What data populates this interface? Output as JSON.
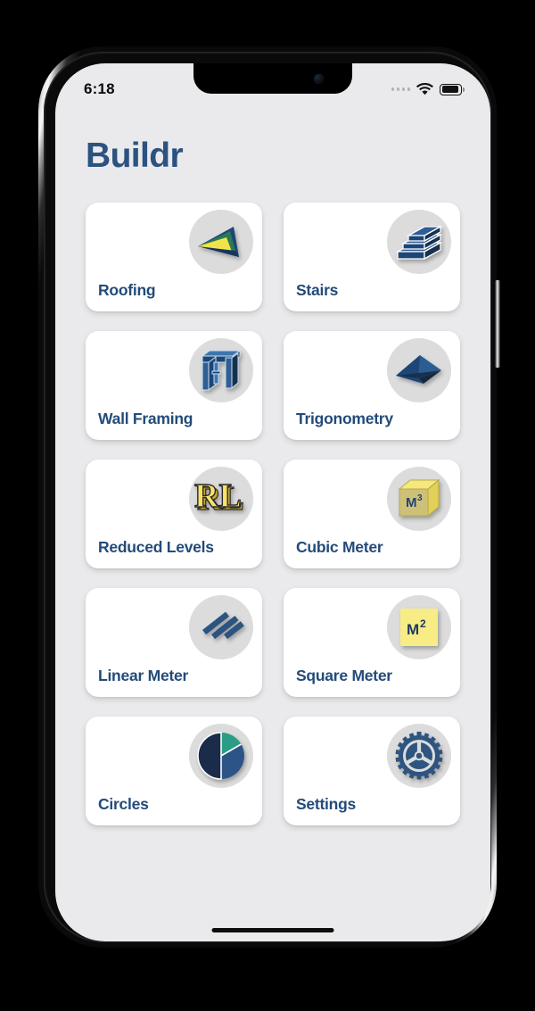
{
  "device": {
    "name": "iphone-mockup",
    "status_bar": {
      "time": "6:18",
      "wifi_icon": "wifi-icon",
      "battery_icon": "battery-icon",
      "signal_icon": "signal-dots-icon"
    },
    "buttons": {
      "silent_switch": "silent-switch",
      "volume_up": "volume-up-button",
      "volume_down": "volume-down-button",
      "power": "power-button"
    },
    "home_indicator": "home-indicator"
  },
  "app": {
    "title": "Buildr",
    "background_color": "#eaeaec",
    "accent_color": "#234b79",
    "card_color": "#ffffff",
    "icon_circle_color": "#dcdcdc"
  },
  "tiles": [
    {
      "label": "Roofing",
      "icon": "roof-triangle-icon"
    },
    {
      "label": "Stairs",
      "icon": "stairs-icon"
    },
    {
      "label": "Wall Framing",
      "icon": "wall-frame-icon"
    },
    {
      "label": "Trigonometry",
      "icon": "triangle-pyramid-icon"
    },
    {
      "label": "Reduced Levels",
      "icon": "rl-letters-icon"
    },
    {
      "label": "Cubic Meter",
      "icon": "cube-m3-icon"
    },
    {
      "label": "Linear Meter",
      "icon": "diagonal-bars-icon"
    },
    {
      "label": "Square Meter",
      "icon": "square-m2-icon"
    },
    {
      "label": "Circles",
      "icon": "pie-chart-icon"
    },
    {
      "label": "Settings",
      "icon": "gear-icon"
    }
  ]
}
